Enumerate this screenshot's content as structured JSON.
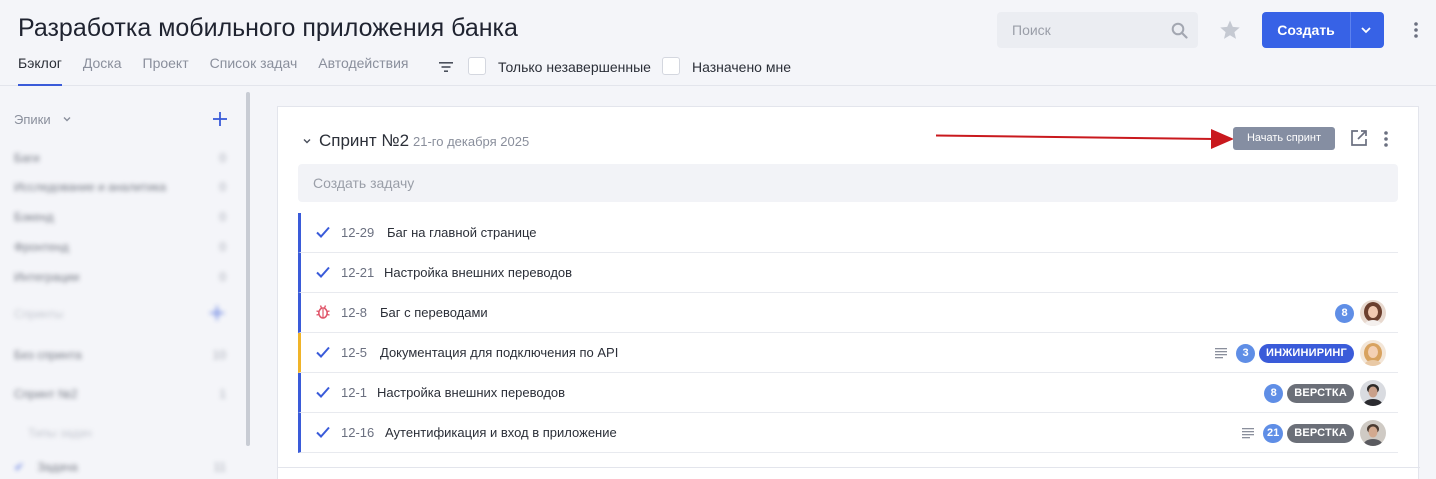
{
  "header": {
    "title": "Разработка мобильного приложения банка",
    "tabs": [
      {
        "label": "Бэклог",
        "active": true
      },
      {
        "label": "Доска",
        "active": false
      },
      {
        "label": "Проект",
        "active": false
      },
      {
        "label": "Список задач",
        "active": false
      },
      {
        "label": "Автодействия",
        "active": false
      }
    ],
    "filters": {
      "only_incomplete": "Только незавершенные",
      "assigned_to_me": "Назначено мне"
    },
    "search_placeholder": "Поиск",
    "create_label": "Создать",
    "accent_color": "#3762e6"
  },
  "sidebar": {
    "epics_title": "Эпики",
    "epics": [
      {
        "label": "Баги",
        "count": "0"
      },
      {
        "label": "Исследование и аналитика",
        "count": "0"
      },
      {
        "label": "Бэкенд",
        "count": "0"
      },
      {
        "label": "Фронтенд",
        "count": "0"
      },
      {
        "label": "Интеграции",
        "count": "0"
      }
    ],
    "sprints_title": "Спринты",
    "sprints": [
      {
        "label": "Без спринта",
        "count": "10"
      },
      {
        "label": "Спринт №2",
        "count": "1"
      }
    ],
    "types_title": "Типы задач",
    "types": [
      {
        "label": "Задача",
        "count": "11"
      }
    ]
  },
  "sprint": {
    "title": "Спринт №2",
    "date": "21-го декабря 2025",
    "start_label": "Начать спринт",
    "create_task_placeholder": "Создать задачу",
    "tasks": [
      {
        "icon": "check-icon",
        "key": "12-29",
        "title": "Баг на главной странице",
        "border": "#3a5bd9"
      },
      {
        "icon": "check-icon",
        "key": "12-21",
        "title": "Настройка внешних переводов",
        "border": "#3a5bd9"
      },
      {
        "icon": "bug-icon",
        "key": "12-8",
        "title": "Баг с переводами",
        "border": "#3a5bd9",
        "points": "8",
        "avatar": "avatar-1"
      },
      {
        "icon": "check-icon",
        "key": "12-5",
        "title": "Документация для подключения по API",
        "border": "#f0b429",
        "has_desc": true,
        "points": "3",
        "tag": "ИНЖИНИРИНГ",
        "tag_color": "#3a5bd9",
        "avatar": "avatar-2"
      },
      {
        "icon": "check-icon",
        "key": "12-1",
        "title": "Настройка внешних переводов",
        "border": "#3a5bd9",
        "points": "8",
        "tag": "ВЕРСТКА",
        "tag_color": "#6b6f78",
        "avatar": "avatar-3"
      },
      {
        "icon": "check-icon",
        "key": "12-16",
        "title": "Аутентификация и вход в приложение",
        "border": "#3a5bd9",
        "has_desc": true,
        "points": "21",
        "tag": "ВЕРСТКА",
        "tag_color": "#6b6f78",
        "avatar": "avatar-4"
      }
    ]
  }
}
